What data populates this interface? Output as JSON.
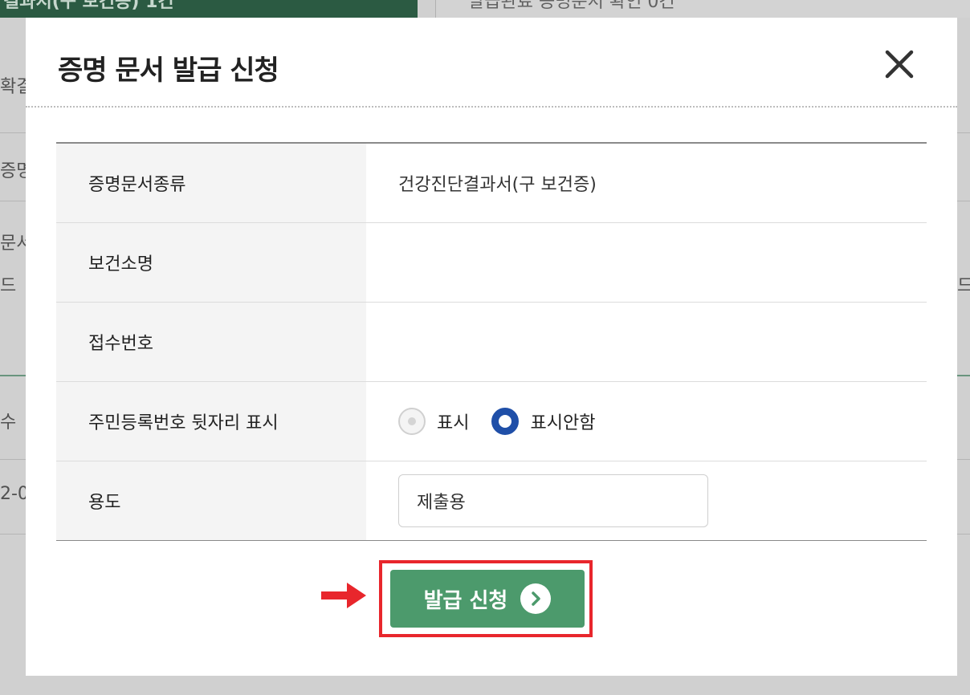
{
  "background": {
    "tab_active_label": "결과서(구 보건증) 1건",
    "tab_inactive_label": "발급완료 증명문서 확인 0건",
    "left_fragments": [
      "확결",
      "증명",
      "문서",
      "드",
      "수",
      "2-0"
    ],
    "right_fragments": [
      "드"
    ]
  },
  "modal": {
    "title": "증명 문서 발급 신청",
    "close_icon": "close-icon"
  },
  "form": {
    "rows": [
      {
        "label": "증명문서종류",
        "value": "건강진단결과서(구 보건증)"
      },
      {
        "label": "보건소명",
        "value": ""
      },
      {
        "label": "접수번호",
        "value": ""
      },
      {
        "label": "주민등록번호 뒷자리 표시"
      },
      {
        "label": "용도"
      }
    ],
    "radio_options": [
      {
        "label": "표시",
        "selected": false
      },
      {
        "label": "표시안함",
        "selected": true
      }
    ],
    "purpose_value": "제출용"
  },
  "submit": {
    "label": "발급 신청",
    "icon": "chevron-right-circle-icon"
  },
  "colors": {
    "accent_green": "#4c9a6c",
    "highlight_red": "#e8262c",
    "radio_blue": "#1f4fa8"
  }
}
